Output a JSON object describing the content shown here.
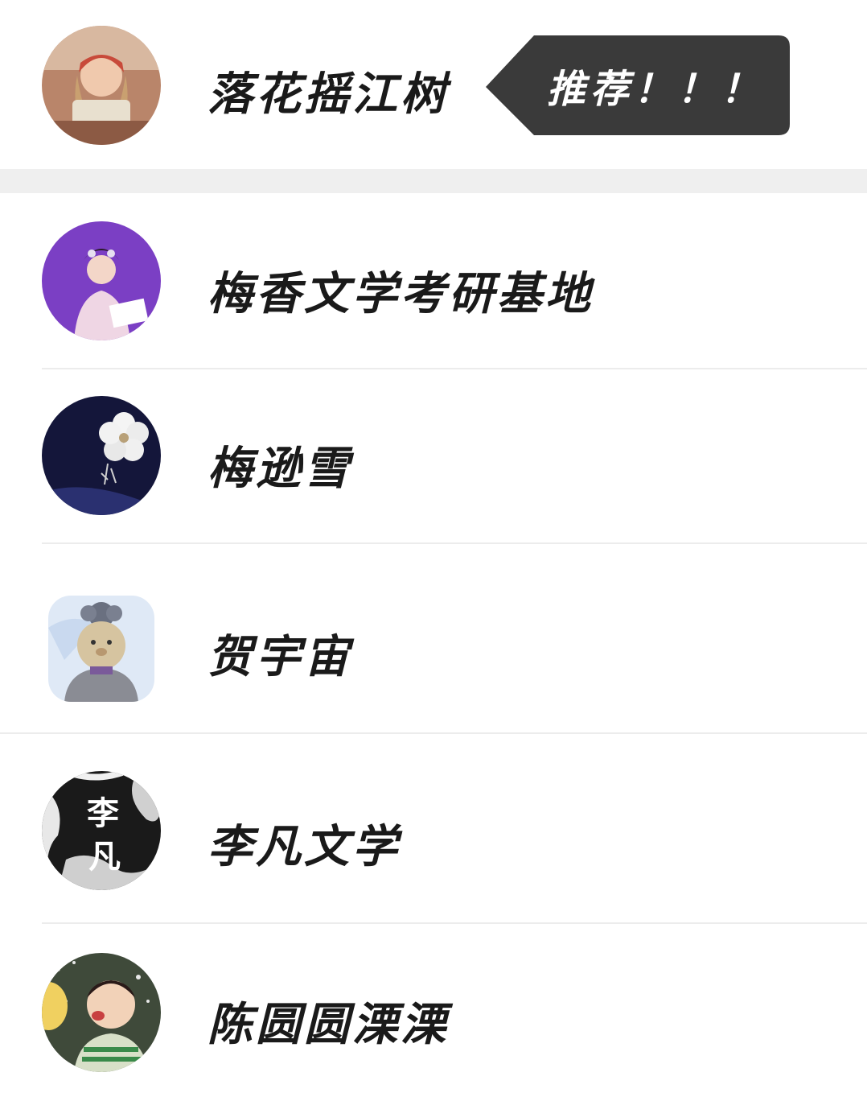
{
  "contacts": [
    {
      "name": "落花摇江树"
    },
    {
      "name": "梅香文学考研基地"
    },
    {
      "name": "梅逊雪"
    },
    {
      "name": "贺宇宙"
    },
    {
      "name": "李凡文学",
      "avatar_text_1": "李",
      "avatar_text_2": "凡"
    },
    {
      "name": "陈圆圆溧溧"
    }
  ],
  "tooltip": {
    "text": "推荐！！！"
  },
  "colors": {
    "tooltip_bg": "#3a3a3a",
    "divider": "#ececec",
    "section_gap": "#efefef",
    "purple_avatar": "#7b3fc4",
    "navy_avatar": "#14163a"
  }
}
